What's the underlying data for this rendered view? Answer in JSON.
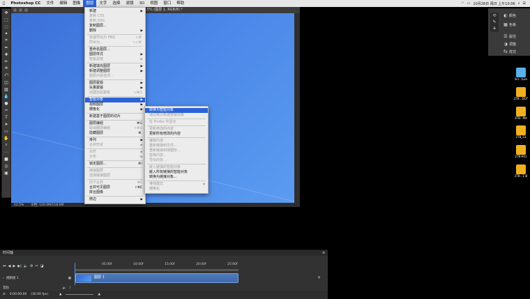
{
  "menubar": {
    "app_name": "Photoshop CC",
    "items": [
      "文件",
      "编辑",
      "图像",
      "图层",
      "文字",
      "选择",
      "滤镜",
      "3D",
      "视图",
      "窗口",
      "帮助"
    ],
    "active_index": 3,
    "clock": "10月28日 周日 上午10:06"
  },
  "document": {
    "tab_title": "1.5% (图层 1, RGB/8) *",
    "zoom": "12.5%",
    "doc_info": "文档: 120.0M/118.0M"
  },
  "layer_menu": {
    "items": [
      {
        "label": "新建",
        "arrow": true,
        "dis": false
      },
      {
        "label": "复制 CSS",
        "dis": true
      },
      {
        "label": "复制 SVG",
        "dis": true
      },
      {
        "label": "复制图层...",
        "dis": false
      },
      {
        "label": "删除",
        "arrow": true,
        "dis": false
      },
      {
        "sep": true
      },
      {
        "label": "快速导出为 PNG",
        "shortcut": "⇧⌘'",
        "dis": true
      },
      {
        "label": "导出为...",
        "shortcut": "⌥⇧⌘'",
        "dis": true
      },
      {
        "sep": true
      },
      {
        "label": "重命名图层...",
        "dis": false
      },
      {
        "label": "图层样式",
        "arrow": true,
        "dis": false
      },
      {
        "label": "智能滤镜",
        "arrow": true,
        "dis": true
      },
      {
        "sep": true
      },
      {
        "label": "新建填充图层",
        "arrow": true,
        "dis": false
      },
      {
        "label": "新建调整图层",
        "arrow": true,
        "dis": false
      },
      {
        "label": "图层内容选项...",
        "dis": true
      },
      {
        "sep": true
      },
      {
        "label": "图层蒙版",
        "arrow": true,
        "dis": false
      },
      {
        "label": "矢量蒙版",
        "arrow": true,
        "dis": false
      },
      {
        "label": "创建剪贴蒙版",
        "shortcut": "⌥⌘G",
        "dis": true
      },
      {
        "sep": true
      },
      {
        "label": "智能对象",
        "arrow": true,
        "dis": false,
        "sel": true
      },
      {
        "label": "视频图层",
        "arrow": true,
        "dis": false
      },
      {
        "label": "栅格化",
        "arrow": true,
        "dis": false
      },
      {
        "sep": true
      },
      {
        "label": "新建基于图层的切片",
        "dis": false
      },
      {
        "sep": true
      },
      {
        "label": "图层编组",
        "shortcut": "⌘G",
        "dis": false
      },
      {
        "label": "取消图层编组",
        "shortcut": "⇧⌘G",
        "dis": true
      },
      {
        "label": "隐藏图层",
        "shortcut": "⌘,",
        "dis": false
      },
      {
        "sep": true
      },
      {
        "label": "排列",
        "arrow": true,
        "dis": false
      },
      {
        "label": "合并形状",
        "arrow": true,
        "dis": true
      },
      {
        "sep": true
      },
      {
        "label": "对齐",
        "arrow": true,
        "dis": true
      },
      {
        "label": "分布",
        "arrow": true,
        "dis": true
      },
      {
        "sep": true
      },
      {
        "label": "锁定图层...",
        "shortcut": "⌘/",
        "dis": false
      },
      {
        "sep": true
      },
      {
        "label": "链接图层",
        "dis": true
      },
      {
        "label": "选择链接图层",
        "dis": true
      },
      {
        "sep": true
      },
      {
        "label": "向下合并",
        "shortcut": "⌘E",
        "dis": true
      },
      {
        "label": "合并可见图层",
        "shortcut": "⇧⌘E",
        "dis": false
      },
      {
        "label": "拼合图像",
        "dis": false
      },
      {
        "sep": true
      },
      {
        "label": "修边",
        "arrow": true,
        "dis": false
      }
    ]
  },
  "smart_object_menu": {
    "items": [
      {
        "label": "转换为智能对象",
        "dis": false,
        "sel": true
      },
      {
        "label": "通过拷贝新建智能对象",
        "dis": true
      },
      {
        "sep": true
      },
      {
        "label": "在 Finder 中显示",
        "dis": true
      },
      {
        "sep": true
      },
      {
        "label": "更新修改的内容",
        "dis": true
      },
      {
        "label": "更新所有修改的内容",
        "dis": false
      },
      {
        "sep": true
      },
      {
        "label": "编辑内容",
        "dis": true
      },
      {
        "label": "重新链接到文件...",
        "dis": true
      },
      {
        "label": "重新链接到库图形...",
        "dis": true
      },
      {
        "label": "替换内容...",
        "dis": true
      },
      {
        "label": "导出内容...",
        "dis": true
      },
      {
        "sep": true
      },
      {
        "label": "嵌入链接的智能对象",
        "dis": true
      },
      {
        "label": "嵌入所有链接的智能对象",
        "dis": false
      },
      {
        "label": "转换为链接对象...",
        "dis": false
      },
      {
        "sep": true
      },
      {
        "label": "堆栈模式",
        "arrow": true,
        "dis": true
      },
      {
        "label": "栅格化",
        "dis": true
      }
    ]
  },
  "right_panel": {
    "items": [
      {
        "icon": "color-wheel-icon",
        "label": "颜色"
      },
      {
        "icon": "swatches-icon",
        "label": "色板"
      },
      {
        "icon": "properties-icon",
        "label": "属性"
      },
      {
        "icon": "adjustments-icon",
        "label": "调整"
      },
      {
        "icon": "styles-icon",
        "label": "样式"
      }
    ]
  },
  "desktop_icons": [
    {
      "label": "Scr...ture",
      "color": "#5ab0e8"
    },
    {
      "label": "2TB...DOT",
      "color": "#f0b020"
    },
    {
      "label": "2TB...MA",
      "color": "#f0b020"
    },
    {
      "label": "2TB_23",
      "color": "#f0b020"
    },
    {
      "label": "2TB-A01",
      "color": "#f0b020"
    },
    {
      "label": "2TB...1-B",
      "color": "#f0b020"
    }
  ],
  "timeline": {
    "title": "时间轴",
    "ruler": [
      "05:00f",
      "10:00f",
      "15:00f",
      "20:00f",
      "25:00f"
    ],
    "track_name": "视频组 1",
    "clip_label": "图层 1",
    "audio_label": "音轨",
    "timecode": "0:00:00:00",
    "fps": "(30.00 fps)"
  }
}
